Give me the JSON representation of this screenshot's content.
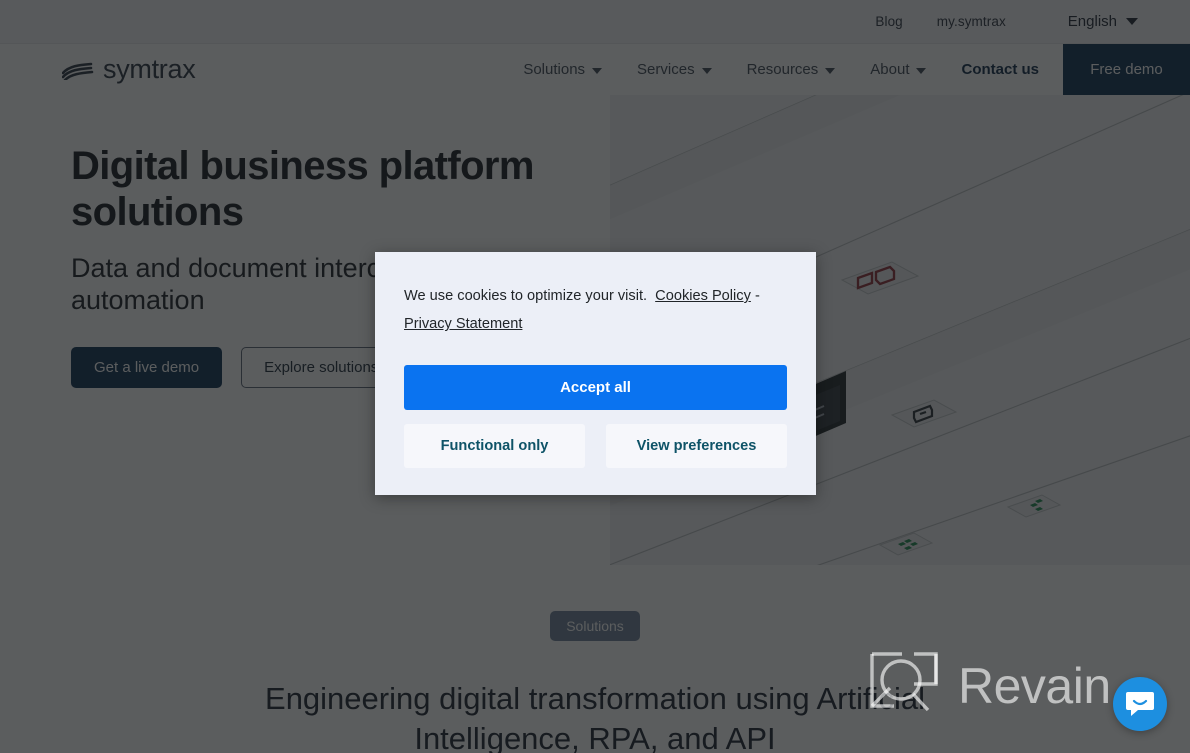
{
  "utility_bar": {
    "links": [
      {
        "label": "Blog",
        "name": "blog-link"
      },
      {
        "label": "my.symtrax",
        "name": "my-symtrax-link"
      }
    ],
    "language": {
      "label": "English",
      "icon": "chevron-down-icon"
    }
  },
  "navbar": {
    "brand": {
      "text": "symtrax",
      "icon": "symtrax-wave-logo-icon"
    },
    "items": [
      {
        "label": "Solutions",
        "has_dropdown": true
      },
      {
        "label": "Services",
        "has_dropdown": true
      },
      {
        "label": "Resources",
        "has_dropdown": true
      },
      {
        "label": "About",
        "has_dropdown": true
      },
      {
        "label": "Contact us",
        "has_dropdown": false
      }
    ],
    "cta": {
      "label": "Free demo",
      "color": "#0b2f52"
    }
  },
  "hero": {
    "title": "Digital business platform solutions",
    "subtitle": "Data and document interchange automation",
    "primary_button": "Get a live demo",
    "secondary_button": "Explore solutions"
  },
  "section": {
    "badge": "Solutions",
    "title": "Engineering digital transformation using Artificial Intelligence, RPA, and API"
  },
  "cookie_dialog": {
    "message_prefix": "We use cookies to optimize your visit.",
    "cookies_policy_link": "Cookies Policy",
    "separator": "-",
    "privacy_link": "Privacy Statement",
    "accept_all": "Accept all",
    "functional_only": "Functional only",
    "view_preferences": "View preferences",
    "accent_color": "#0a73f0",
    "background_color": "#eceff7"
  },
  "watermark": {
    "text": "Revain",
    "icon": "revain-logo-icon"
  },
  "chat_widget": {
    "icon": "chat-smile-bubble-icon",
    "color": "#1d8fe0"
  }
}
